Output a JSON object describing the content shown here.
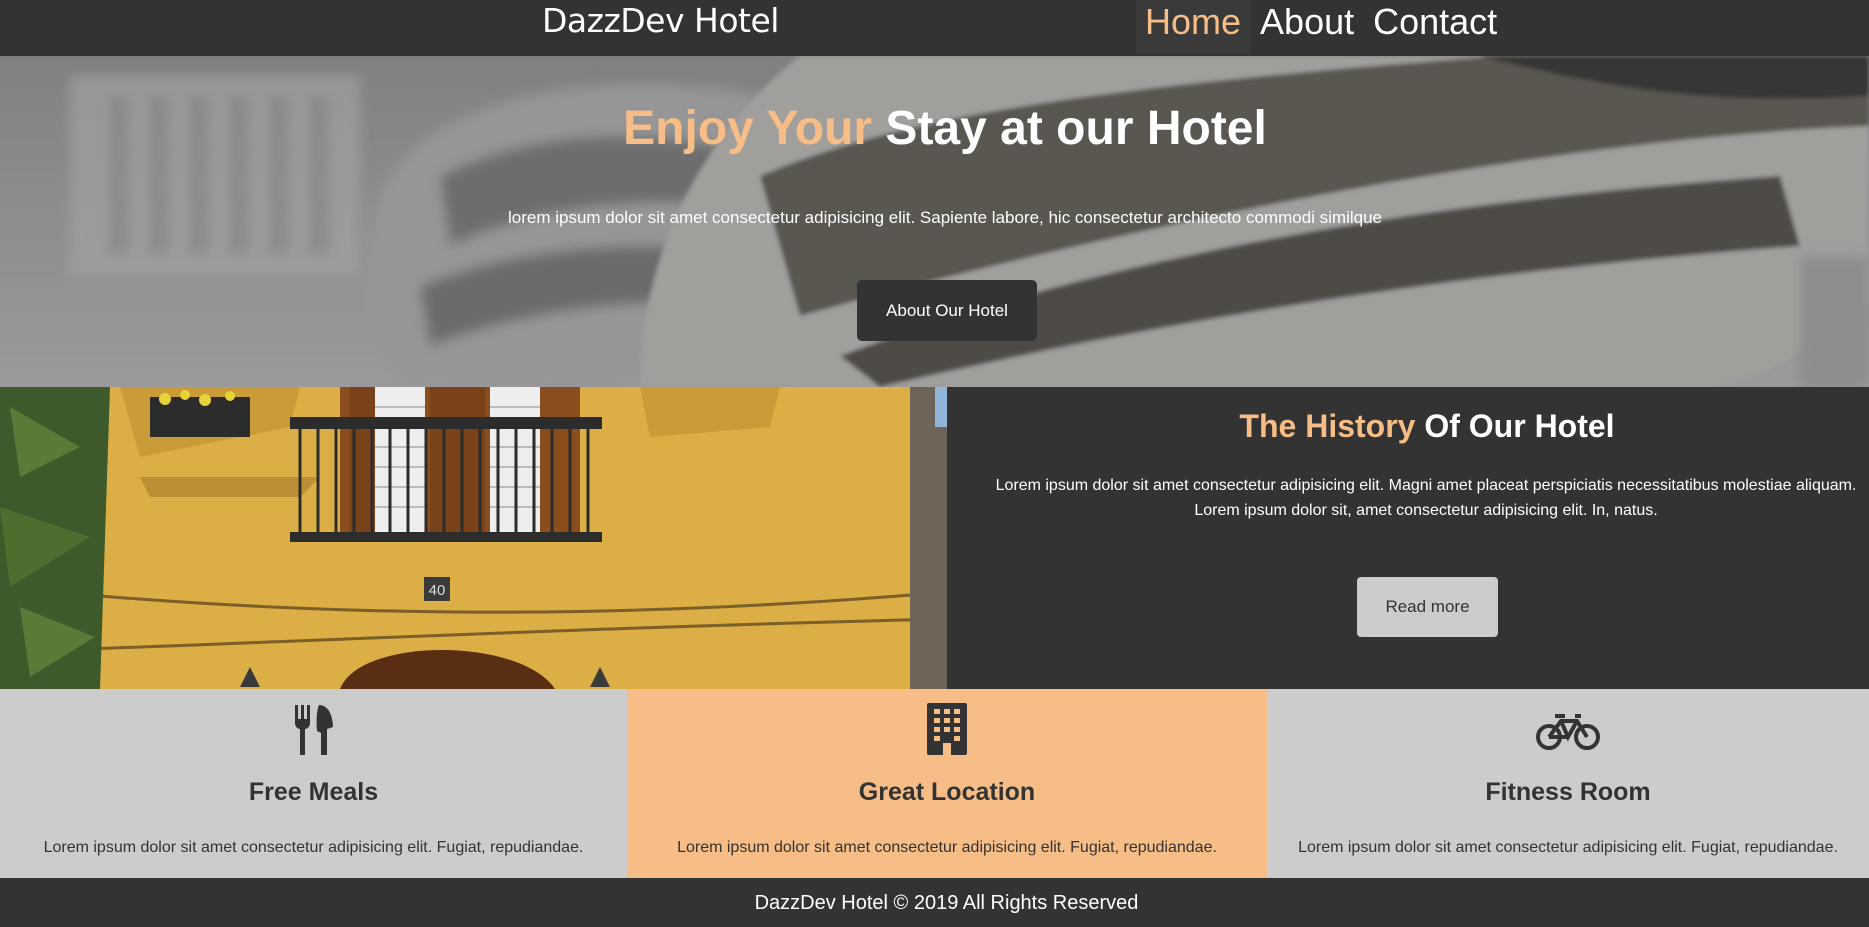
{
  "navbar": {
    "brand": "DazzDev Hotel",
    "links": [
      {
        "label": "Home",
        "active": true
      },
      {
        "label": "About",
        "active": false
      },
      {
        "label": "Contact",
        "active": false
      }
    ]
  },
  "hero": {
    "title_accent": "Enjoy Your",
    "title_rest": " Stay at our Hotel",
    "text": "lorem ipsum dolor sit amet consectetur adipisicing elit. Sapiente labore, hic consectetur architecto commodi similque",
    "button_label": "About Our Hotel"
  },
  "history": {
    "title_accent": "The History",
    "title_rest": " Of Our Hotel",
    "text": "Lorem ipsum dolor sit amet consectetur adipisicing elit. Magni amet placeat perspiciatis necessitatibus molestiae aliquam. Lorem ipsum dolor sit, amet consectetur adipisicing elit. In, natus.",
    "button_label": "Read more",
    "photo_house_number": "40"
  },
  "features": [
    {
      "icon": "utensils-icon",
      "title": "Free Meals",
      "text": "Lorem ipsum dolor sit amet consectetur adipisicing elit. Fugiat, repudiandae."
    },
    {
      "icon": "building-icon",
      "title": "Great Location",
      "text": "Lorem ipsum dolor sit amet consectetur adipisicing elit. Fugiat, repudiandae."
    },
    {
      "icon": "bicycle-icon",
      "title": "Fitness Room",
      "text": "Lorem ipsum dolor sit amet consectetur adipisicing elit. Fugiat, repudiandae."
    }
  ],
  "footer": {
    "text": "DazzDev Hotel © 2019 All Rights Reserved"
  },
  "colors": {
    "dark": "#333333",
    "accent": "#f7bd86",
    "light": "#cccccc",
    "white": "#ffffff"
  }
}
